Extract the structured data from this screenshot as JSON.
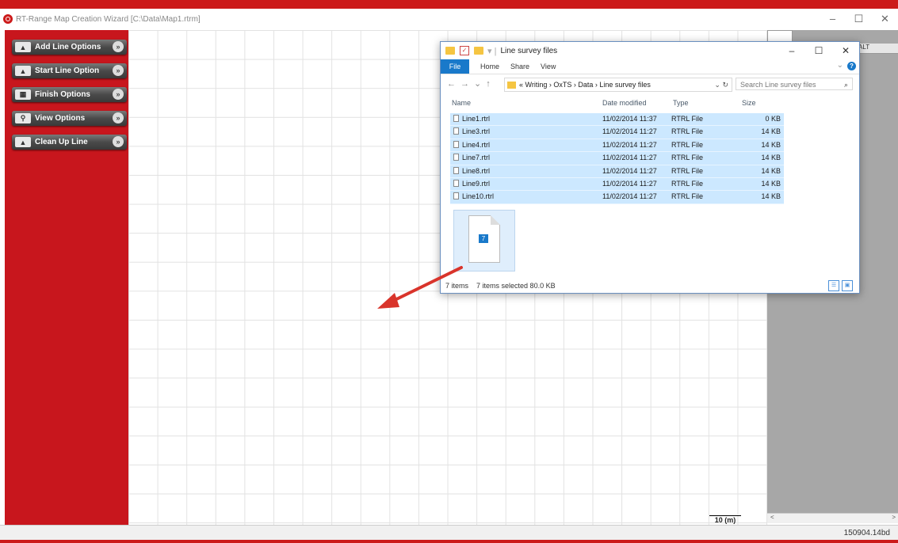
{
  "app": {
    "title": "RT-Range Map Creation Wizard  [C:\\Data\\Map1.rtrm]",
    "controls": [
      "–",
      "☐",
      "✕"
    ]
  },
  "sidebar": {
    "buttons": [
      {
        "label": "Add Line Options",
        "icon": "road-icon"
      },
      {
        "label": "Start Line Option",
        "icon": "road-icon"
      },
      {
        "label": "Finish Options",
        "icon": "checkered-flag-icon"
      },
      {
        "label": "View Options",
        "icon": "magnifier-icon"
      },
      {
        "label": "Clean Up Line",
        "icon": "road-icon"
      }
    ]
  },
  "map": {
    "scale_label": "10 (m)"
  },
  "right_panel": {
    "column_header": "ALT"
  },
  "status": {
    "version": "150904.14bd"
  },
  "explorer": {
    "title": "Line survey files",
    "controls": [
      "–",
      "☐",
      "✕"
    ],
    "ribbon_tabs": [
      "File",
      "Home",
      "Share",
      "View"
    ],
    "breadcrumb": [
      "«",
      "Writing",
      "OxTS",
      "Data",
      "Line survey files"
    ],
    "search_placeholder": "Search Line survey files",
    "columns": [
      "Name",
      "Date modified",
      "Type",
      "Size"
    ],
    "files": [
      {
        "name": "Line1.rtrl",
        "date": "11/02/2014 11:37",
        "type": "RTRL File",
        "size": "0 KB"
      },
      {
        "name": "Line3.rtrl",
        "date": "11/02/2014 11:27",
        "type": "RTRL File",
        "size": "14 KB"
      },
      {
        "name": "Line4.rtrl",
        "date": "11/02/2014 11:27",
        "type": "RTRL File",
        "size": "14 KB"
      },
      {
        "name": "Line7.rtrl",
        "date": "11/02/2014 11:27",
        "type": "RTRL File",
        "size": "14 KB"
      },
      {
        "name": "Line8.rtrl",
        "date": "11/02/2014 11:27",
        "type": "RTRL File",
        "size": "14 KB"
      },
      {
        "name": "Line9.rtrl",
        "date": "11/02/2014 11:27",
        "type": "RTRL File",
        "size": "14 KB"
      },
      {
        "name": "Line10.rtrl",
        "date": "11/02/2014 11:27",
        "type": "RTRL File",
        "size": "14 KB"
      }
    ],
    "drag_count": "7",
    "status_items": "7 items",
    "status_selected": "7 items selected  80.0 KB"
  },
  "colors": {
    "brand_red": "#c8161d",
    "selection_blue": "#cce8ff",
    "accent_blue": "#1979ca",
    "arrow_red": "#d9342b"
  }
}
